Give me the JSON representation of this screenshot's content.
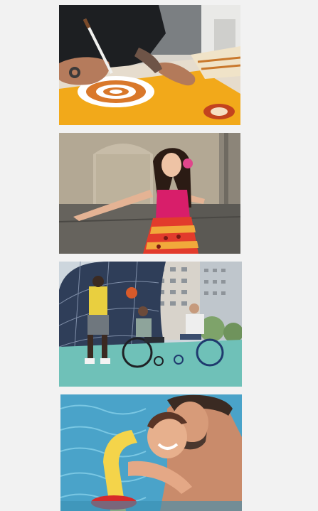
{
  "gallery": {
    "tiles": [
      {
        "icon": "photo-artist-painting-dot-art"
      },
      {
        "icon": "photo-woman-dancing"
      },
      {
        "icon": "photo-wheelchair-basketball"
      },
      {
        "icon": "photo-father-child-swimming-pool"
      }
    ]
  },
  "colors": {
    "background": "#f2f2f2",
    "painting_yellow": "#f2a91a",
    "dress_pink": "#d81e6a",
    "court_teal": "#6fc1b8",
    "pool_blue": "#4aa3c9",
    "float_yellow": "#f4d44a"
  }
}
